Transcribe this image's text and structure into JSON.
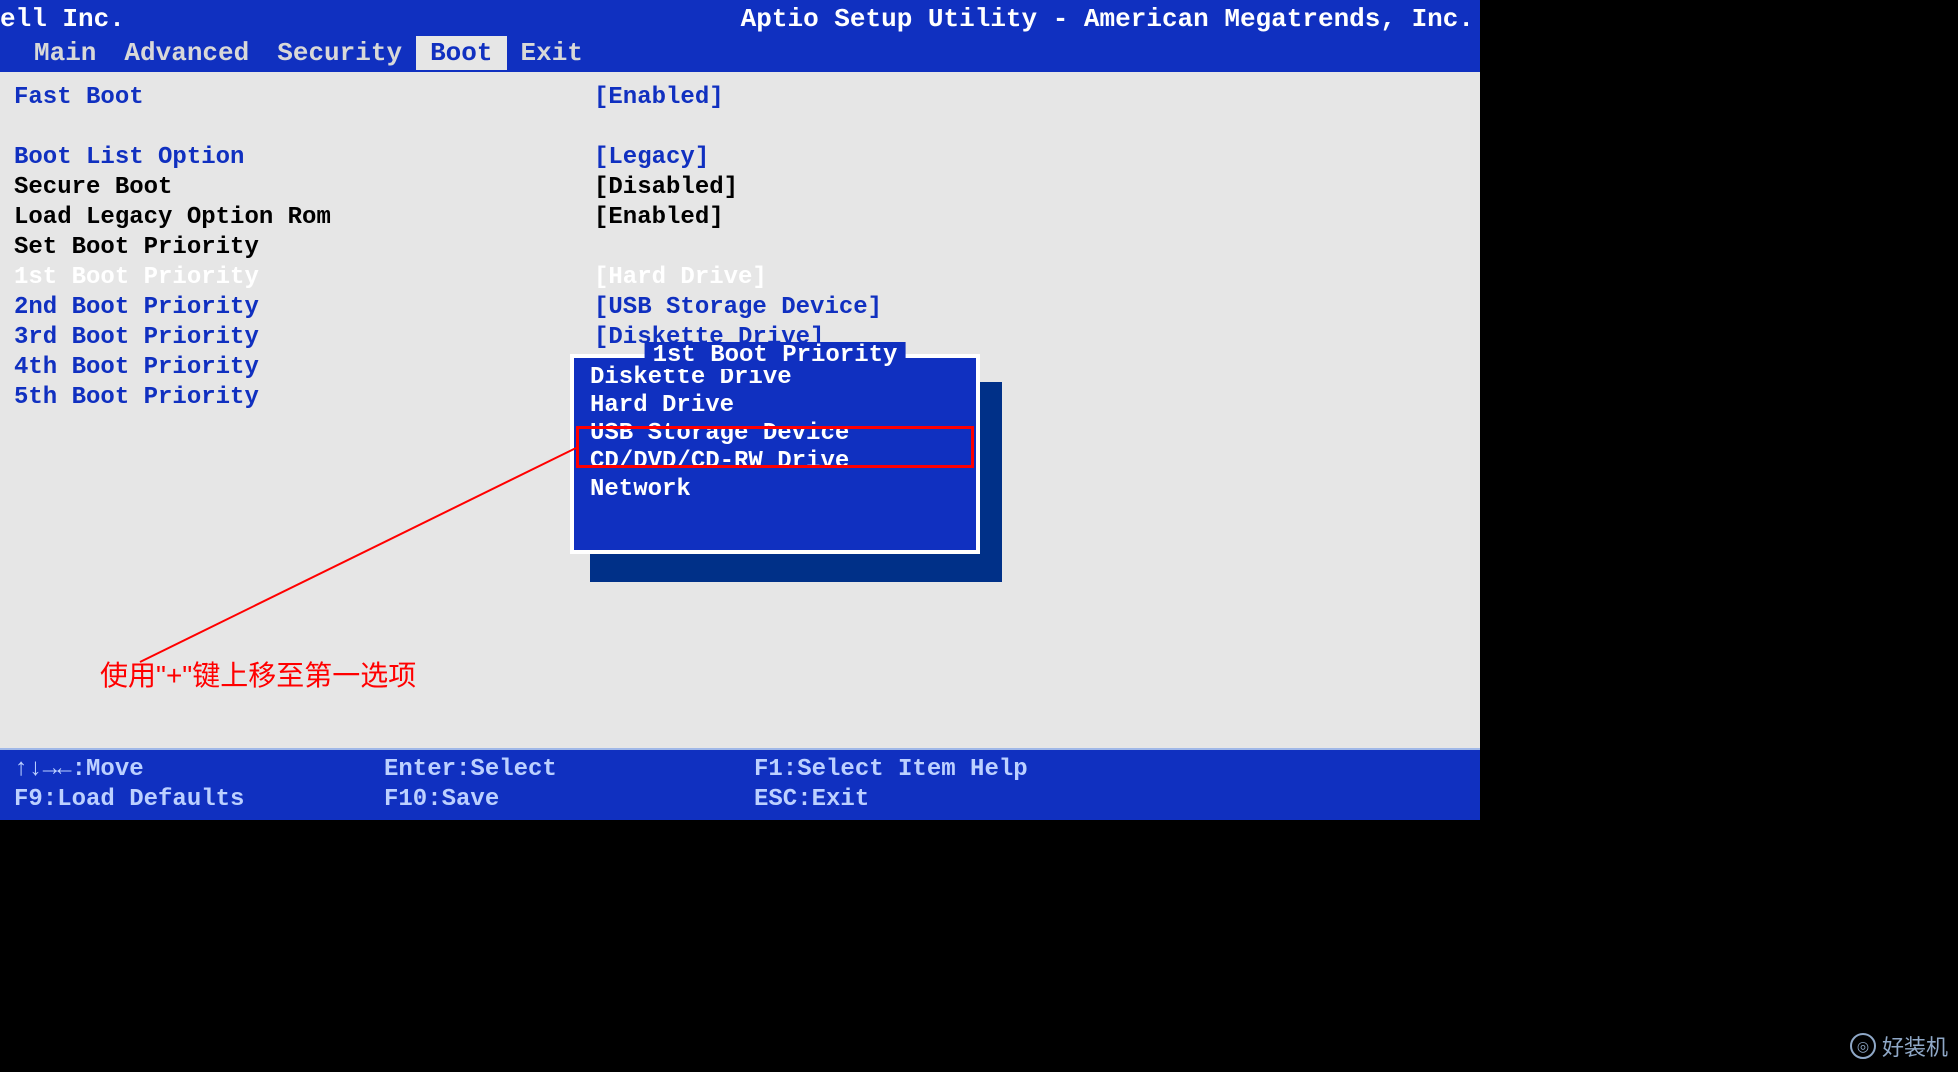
{
  "vendor": "ell Inc.",
  "utility_title": "Aptio Setup Utility - American Megatrends, Inc.",
  "tabs": {
    "main": "Main",
    "advanced": "Advanced",
    "security": "Security",
    "boot": "Boot",
    "exit": "Exit"
  },
  "settings": {
    "fast_boot": {
      "label": "Fast Boot",
      "value": "[Enabled]"
    },
    "boot_list_option": {
      "label": "Boot List Option",
      "value": "[Legacy]"
    },
    "secure_boot": {
      "label": "Secure Boot",
      "value": "[Disabled]"
    },
    "load_legacy_option_rom": {
      "label": "Load Legacy Option Rom",
      "value": "[Enabled]"
    },
    "set_boot_priority": {
      "label": "Set Boot Priority",
      "value": ""
    },
    "boot1": {
      "label": "1st Boot Priority",
      "value": "[Hard Drive]"
    },
    "boot2": {
      "label": "2nd Boot Priority",
      "value": "[USB Storage Device]"
    },
    "boot3": {
      "label": "3rd Boot Priority",
      "value": "[Diskette Drive]"
    },
    "boot4": {
      "label": "4th Boot Priority",
      "value": ""
    },
    "boot5": {
      "label": "5th Boot Priority",
      "value": ""
    }
  },
  "popup": {
    "title": "1st Boot Priority",
    "items": [
      "Diskette Drive",
      "Hard Drive",
      "USB Storage Device",
      "CD/DVD/CD-RW Drive",
      "Network"
    ]
  },
  "annotation": "使用\"+\"键上移至第一选项",
  "footer": {
    "move": "↑↓→←:Move",
    "enter": "Enter:Select",
    "f1": "F1:Select Item Help",
    "f9": "F9:Load Defaults",
    "f10": "F10:Save",
    "esc": "ESC:Exit"
  },
  "watermark": "好装机"
}
